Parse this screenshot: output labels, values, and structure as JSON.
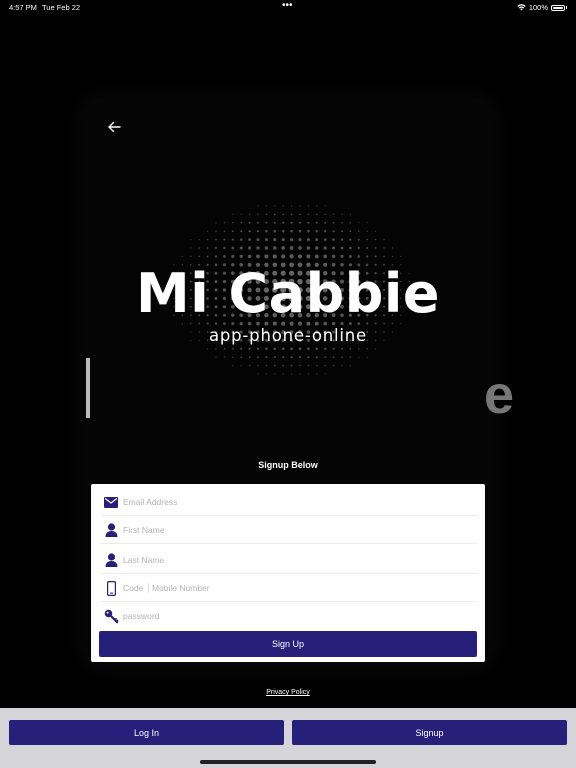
{
  "status_bar": {
    "time": "4:57 PM",
    "date": "Tue Feb 22",
    "dots": "•••",
    "battery": "100%"
  },
  "logo": {
    "title": "Mi Cabbie",
    "subtitle": "app-phone-online",
    "ghost_letter": "e"
  },
  "form": {
    "heading": "Signup Below",
    "email_placeholder": "Email Address",
    "first_name_placeholder": "First Name",
    "last_name_placeholder": "Last Name",
    "code_placeholder": "Code",
    "mobile_placeholder": "Mobile Number",
    "password_placeholder": "password",
    "submit_label": "Sign Up"
  },
  "privacy_link": "Privacy Policy",
  "bottom_nav": {
    "login_label": "Log In",
    "signup_label": "Signup"
  },
  "colors": {
    "accent": "#26207a",
    "background": "#000000",
    "bottom_bar": "#d5d4d9"
  },
  "icons": {
    "back": "arrow-left-icon",
    "email": "envelope-icon",
    "first_name": "person-icon",
    "last_name": "person-icon",
    "mobile": "phone-icon",
    "password": "key-icon",
    "wifi": "wifi-icon",
    "battery": "battery-icon"
  }
}
